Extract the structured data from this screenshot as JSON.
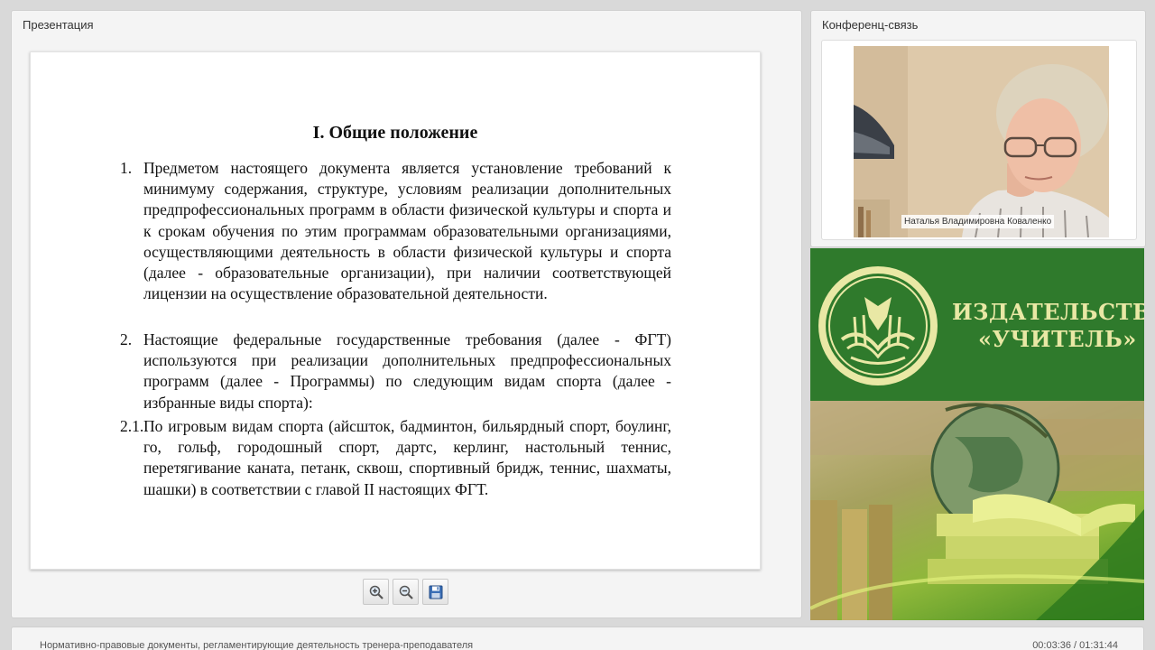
{
  "presentation": {
    "title": "Презентация",
    "slide": {
      "heading": "I. Общие положение",
      "paragraphs": [
        {
          "num": "1.",
          "text": "Предметом настоящего документа является установление требований к минимуму содержания, структуре, условиям реализации дополнительных предпрофессиональных программ в области физической культуры и спорта и к срокам обучения по этим программам образовательными организациями, осуществляющими деятельность в области физической культуры и спорта (далее - образовательные организации), при наличии соответствующей лицензии на осуществление образовательной деятельности."
        },
        {
          "num": "2.",
          "text": "Настоящие федеральные государственные требования (далее - ФГТ) используются при реализации дополнительных предпрофессиональных программ (далее - Программы) по следующим видам спорта (далее - избранные виды спорта):"
        },
        {
          "num": "2.1.",
          "text": "По игровым видам спорта (айсшток, бадминтон, бильярдный спорт, боулинг, го, гольф, городошный спорт, дартс, керлинг, настольный теннис, перетягивание каната, петанк, сквош, спортивный бридж, теннис, шахматы, шашки) в соответствии с главой II настоящих ФГТ."
        }
      ]
    },
    "toolbar": {
      "zoom_in_icon": "zoom-in-icon",
      "zoom_out_icon": "zoom-out-icon",
      "save_icon": "save-icon"
    }
  },
  "conference": {
    "title": "Конференц-связь",
    "participant_name": "Наталья Владимировна Коваленко"
  },
  "ad": {
    "line1": "ИЗДАТЕЛЬСТВО",
    "line2": "«УЧИТЕЛЬ»",
    "colors": {
      "green": "#2f7a2c",
      "text": "#e9e8a5"
    }
  },
  "footer": {
    "title": "Нормативно-правовые документы, регламентирующие деятельность тренера-преподавателя",
    "time": "00:03:36 / 01:31:44"
  }
}
